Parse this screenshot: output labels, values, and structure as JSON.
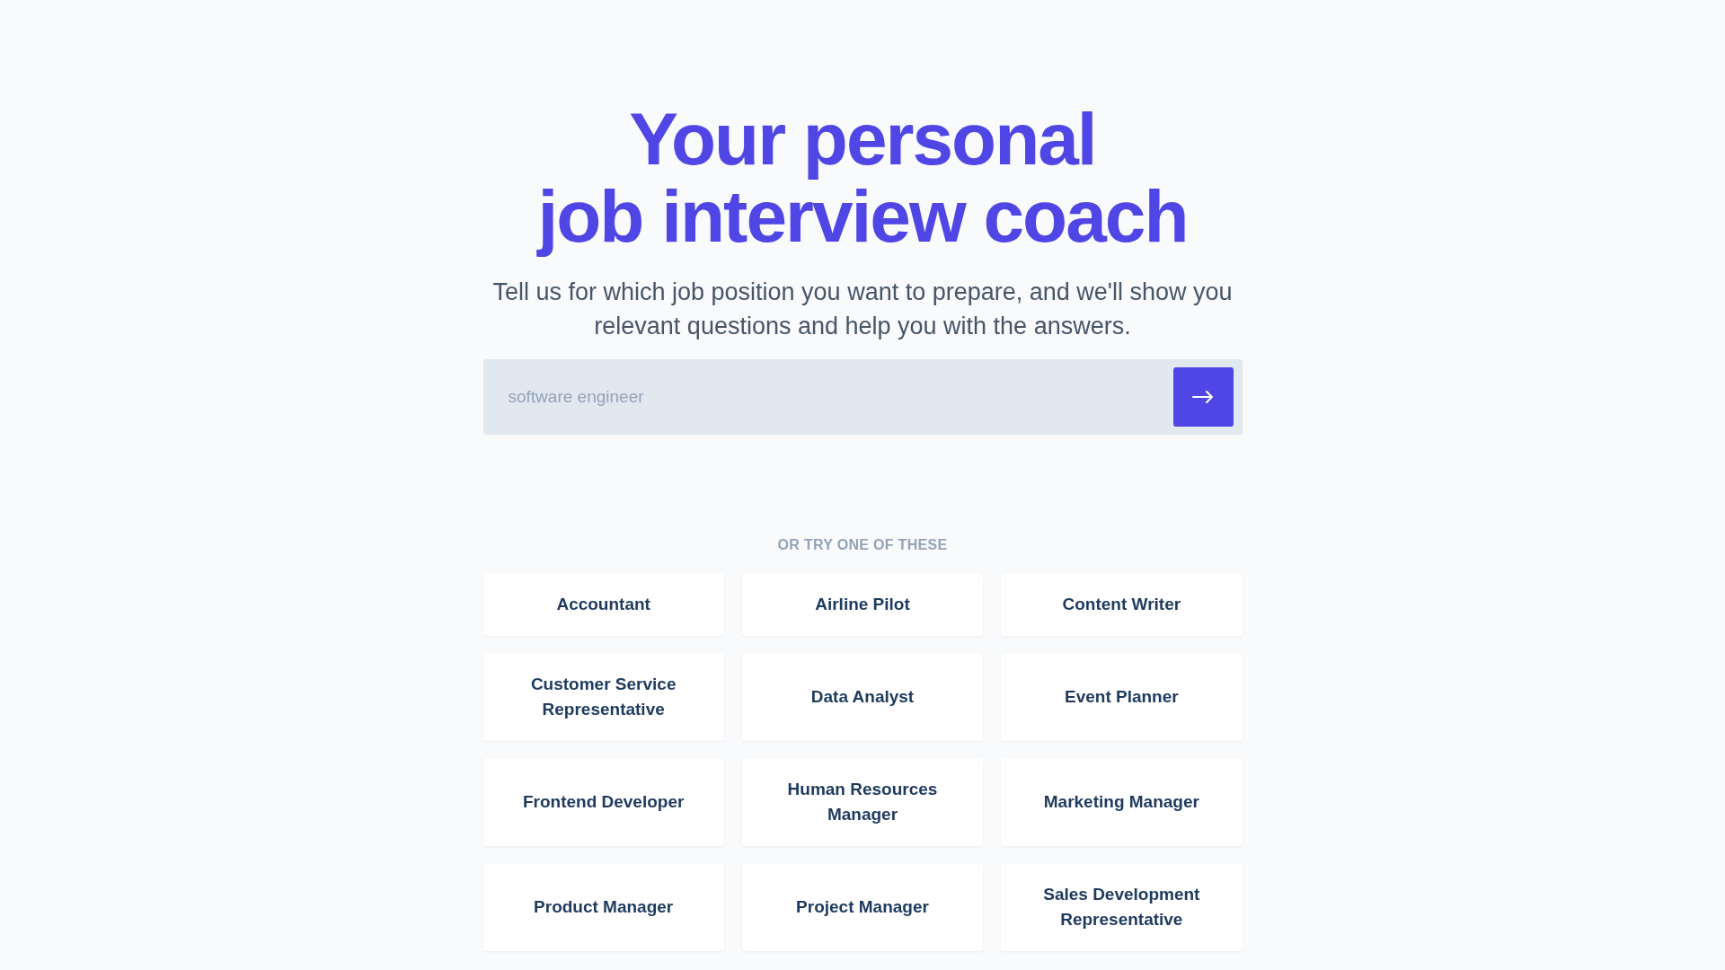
{
  "hero": {
    "title_lines": [
      "Your personal",
      "job interview coach"
    ],
    "subtitle": "Tell us for which job position you want to prepare, and we'll show you relevant questions and help you with the answers."
  },
  "search": {
    "placeholder": "software engineer"
  },
  "suggestions": {
    "heading": "OR TRY ONE OF THESE",
    "items": [
      "Accountant",
      "Airline Pilot",
      "Content Writer",
      "Customer Service Representative",
      "Data Analyst",
      "Event Planner",
      "Frontend Developer",
      "Human Resources Manager",
      "Marketing Manager",
      "Product Manager",
      "Project Manager",
      "Sales Development Representative"
    ]
  }
}
